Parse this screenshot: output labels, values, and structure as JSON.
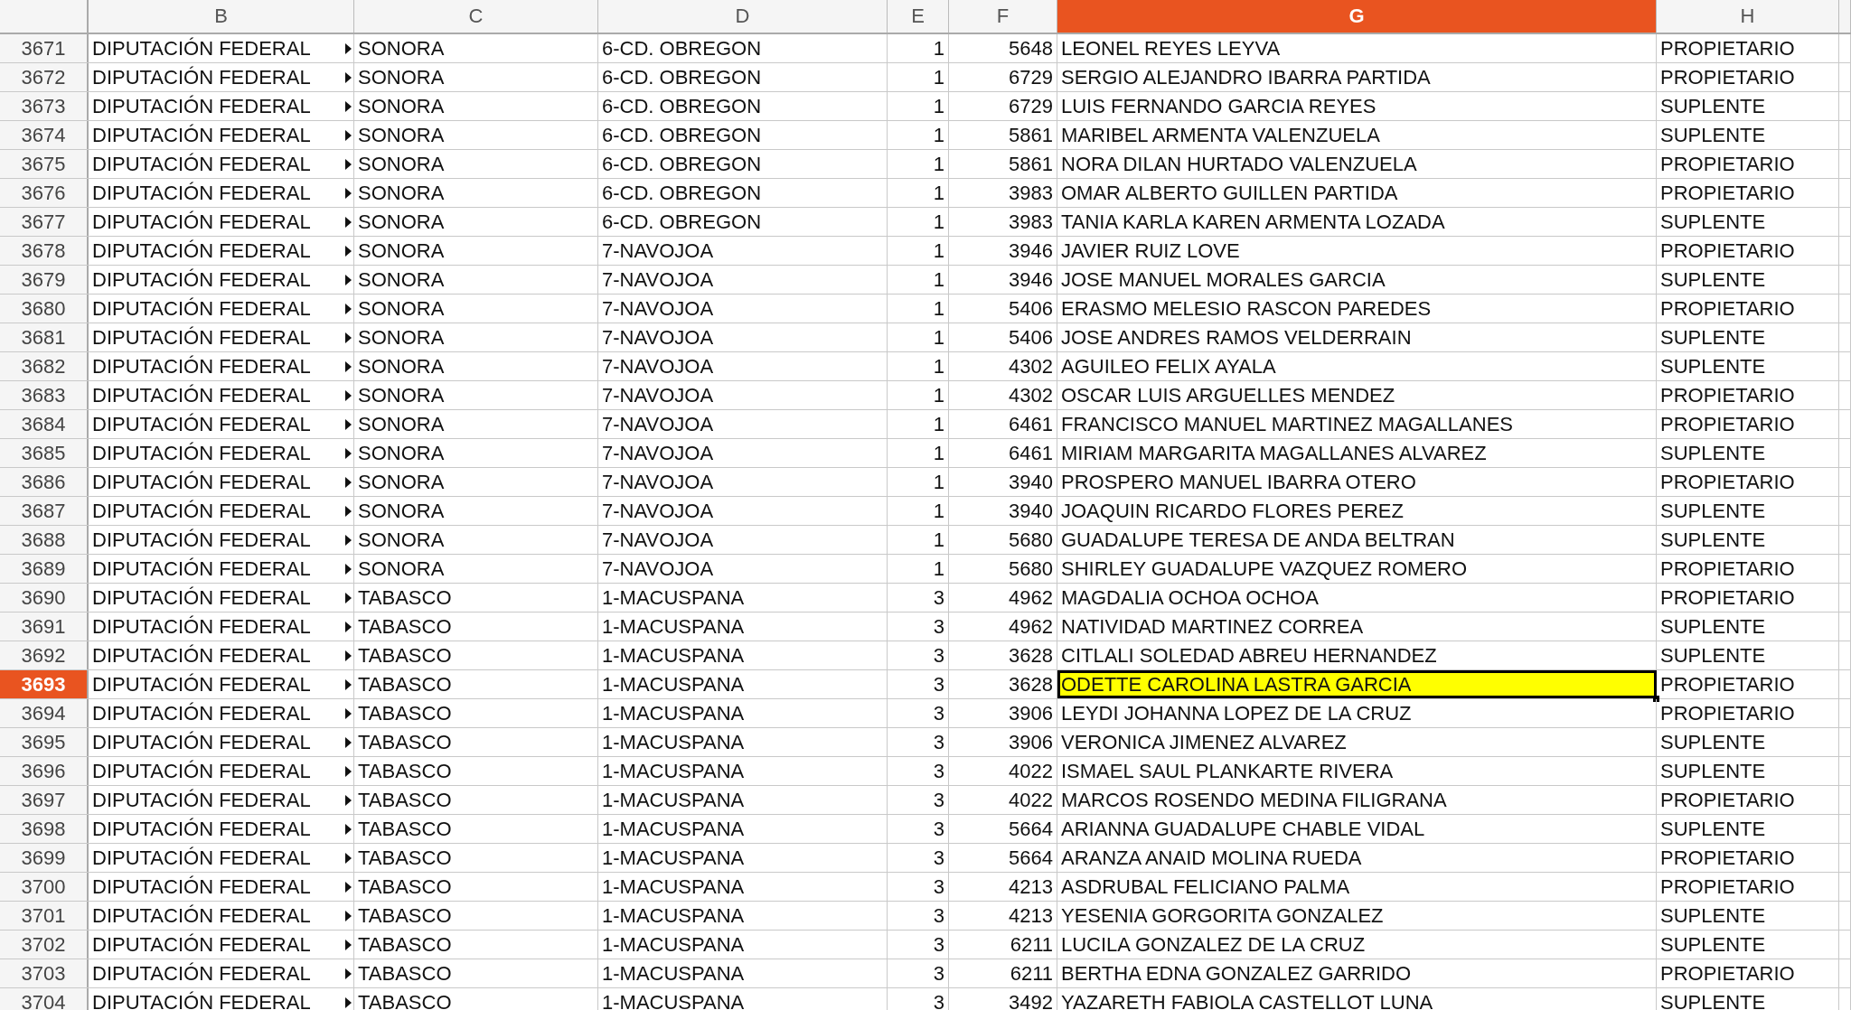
{
  "columns": [
    {
      "label": "B",
      "selected": false
    },
    {
      "label": "C",
      "selected": false
    },
    {
      "label": "D",
      "selected": false
    },
    {
      "label": "E",
      "selected": false
    },
    {
      "label": "F",
      "selected": false
    },
    {
      "label": "G",
      "selected": true
    },
    {
      "label": "H",
      "selected": false
    }
  ],
  "rows": [
    {
      "row": "3671",
      "b": "DIPUTACIÓN FEDERAL",
      "c": "SONORA",
      "d": "6-CD. OBREGON",
      "e": "1",
      "f": "5648",
      "g": "LEONEL REYES LEYVA",
      "h": "PROPIETARIO",
      "selected": false
    },
    {
      "row": "3672",
      "b": "DIPUTACIÓN FEDERAL",
      "c": "SONORA",
      "d": "6-CD. OBREGON",
      "e": "1",
      "f": "6729",
      "g": "SERGIO ALEJANDRO IBARRA PARTIDA",
      "h": "PROPIETARIO",
      "selected": false
    },
    {
      "row": "3673",
      "b": "DIPUTACIÓN FEDERAL",
      "c": "SONORA",
      "d": "6-CD. OBREGON",
      "e": "1",
      "f": "6729",
      "g": "LUIS FERNANDO GARCIA REYES",
      "h": "SUPLENTE",
      "selected": false
    },
    {
      "row": "3674",
      "b": "DIPUTACIÓN FEDERAL",
      "c": "SONORA",
      "d": "6-CD. OBREGON",
      "e": "1",
      "f": "5861",
      "g": "MARIBEL ARMENTA VALENZUELA",
      "h": "SUPLENTE",
      "selected": false
    },
    {
      "row": "3675",
      "b": "DIPUTACIÓN FEDERAL",
      "c": "SONORA",
      "d": "6-CD. OBREGON",
      "e": "1",
      "f": "5861",
      "g": "NORA DILAN HURTADO VALENZUELA",
      "h": "PROPIETARIO",
      "selected": false
    },
    {
      "row": "3676",
      "b": "DIPUTACIÓN FEDERAL",
      "c": "SONORA",
      "d": "6-CD. OBREGON",
      "e": "1",
      "f": "3983",
      "g": "OMAR ALBERTO GUILLEN PARTIDA",
      "h": "PROPIETARIO",
      "selected": false
    },
    {
      "row": "3677",
      "b": "DIPUTACIÓN FEDERAL",
      "c": "SONORA",
      "d": "6-CD. OBREGON",
      "e": "1",
      "f": "3983",
      "g": "TANIA KARLA KAREN ARMENTA LOZADA",
      "h": "SUPLENTE",
      "selected": false
    },
    {
      "row": "3678",
      "b": "DIPUTACIÓN FEDERAL",
      "c": "SONORA",
      "d": "7-NAVOJOA",
      "e": "1",
      "f": "3946",
      "g": "JAVIER RUIZ LOVE",
      "h": "PROPIETARIO",
      "selected": false
    },
    {
      "row": "3679",
      "b": "DIPUTACIÓN FEDERAL",
      "c": "SONORA",
      "d": "7-NAVOJOA",
      "e": "1",
      "f": "3946",
      "g": "JOSE MANUEL MORALES GARCIA",
      "h": "SUPLENTE",
      "selected": false
    },
    {
      "row": "3680",
      "b": "DIPUTACIÓN FEDERAL",
      "c": "SONORA",
      "d": "7-NAVOJOA",
      "e": "1",
      "f": "5406",
      "g": "ERASMO MELESIO RASCON PAREDES",
      "h": "PROPIETARIO",
      "selected": false
    },
    {
      "row": "3681",
      "b": "DIPUTACIÓN FEDERAL",
      "c": "SONORA",
      "d": "7-NAVOJOA",
      "e": "1",
      "f": "5406",
      "g": "JOSE ANDRES RAMOS VELDERRAIN",
      "h": "SUPLENTE",
      "selected": false
    },
    {
      "row": "3682",
      "b": "DIPUTACIÓN FEDERAL",
      "c": "SONORA",
      "d": "7-NAVOJOA",
      "e": "1",
      "f": "4302",
      "g": "AGUILEO FELIX AYALA",
      "h": "SUPLENTE",
      "selected": false
    },
    {
      "row": "3683",
      "b": "DIPUTACIÓN FEDERAL",
      "c": "SONORA",
      "d": "7-NAVOJOA",
      "e": "1",
      "f": "4302",
      "g": "OSCAR LUIS ARGUELLES MENDEZ",
      "h": "PROPIETARIO",
      "selected": false
    },
    {
      "row": "3684",
      "b": "DIPUTACIÓN FEDERAL",
      "c": "SONORA",
      "d": "7-NAVOJOA",
      "e": "1",
      "f": "6461",
      "g": "FRANCISCO MANUEL MARTINEZ MAGALLANES",
      "h": "PROPIETARIO",
      "selected": false
    },
    {
      "row": "3685",
      "b": "DIPUTACIÓN FEDERAL",
      "c": "SONORA",
      "d": "7-NAVOJOA",
      "e": "1",
      "f": "6461",
      "g": "MIRIAM MARGARITA MAGALLANES ALVAREZ",
      "h": "SUPLENTE",
      "selected": false
    },
    {
      "row": "3686",
      "b": "DIPUTACIÓN FEDERAL",
      "c": "SONORA",
      "d": "7-NAVOJOA",
      "e": "1",
      "f": "3940",
      "g": "PROSPERO MANUEL IBARRA OTERO",
      "h": "PROPIETARIO",
      "selected": false
    },
    {
      "row": "3687",
      "b": "DIPUTACIÓN FEDERAL",
      "c": "SONORA",
      "d": "7-NAVOJOA",
      "e": "1",
      "f": "3940",
      "g": "JOAQUIN RICARDO FLORES PEREZ",
      "h": "SUPLENTE",
      "selected": false
    },
    {
      "row": "3688",
      "b": "DIPUTACIÓN FEDERAL",
      "c": "SONORA",
      "d": "7-NAVOJOA",
      "e": "1",
      "f": "5680",
      "g": "GUADALUPE TERESA DE ANDA BELTRAN",
      "h": "SUPLENTE",
      "selected": false
    },
    {
      "row": "3689",
      "b": "DIPUTACIÓN FEDERAL",
      "c": "SONORA",
      "d": "7-NAVOJOA",
      "e": "1",
      "f": "5680",
      "g": "SHIRLEY GUADALUPE VAZQUEZ ROMERO",
      "h": "PROPIETARIO",
      "selected": false
    },
    {
      "row": "3690",
      "b": "DIPUTACIÓN FEDERAL",
      "c": "TABASCO",
      "d": "1-MACUSPANA",
      "e": "3",
      "f": "4962",
      "g": "MAGDALIA OCHOA OCHOA",
      "h": "PROPIETARIO",
      "selected": false
    },
    {
      "row": "3691",
      "b": "DIPUTACIÓN FEDERAL",
      "c": "TABASCO",
      "d": "1-MACUSPANA",
      "e": "3",
      "f": "4962",
      "g": "NATIVIDAD MARTINEZ CORREA",
      "h": "SUPLENTE",
      "selected": false
    },
    {
      "row": "3692",
      "b": "DIPUTACIÓN FEDERAL",
      "c": "TABASCO",
      "d": "1-MACUSPANA",
      "e": "3",
      "f": "3628",
      "g": "CITLALI SOLEDAD ABREU HERNANDEZ",
      "h": "SUPLENTE",
      "selected": false
    },
    {
      "row": "3693",
      "b": "DIPUTACIÓN FEDERAL",
      "c": "TABASCO",
      "d": "1-MACUSPANA",
      "e": "3",
      "f": "3628",
      "g": "ODETTE CAROLINA LASTRA GARCIA",
      "h": "PROPIETARIO",
      "selected": true
    },
    {
      "row": "3694",
      "b": "DIPUTACIÓN FEDERAL",
      "c": "TABASCO",
      "d": "1-MACUSPANA",
      "e": "3",
      "f": "3906",
      "g": "LEYDI JOHANNA LOPEZ DE LA CRUZ",
      "h": "PROPIETARIO",
      "selected": false
    },
    {
      "row": "3695",
      "b": "DIPUTACIÓN FEDERAL",
      "c": "TABASCO",
      "d": "1-MACUSPANA",
      "e": "3",
      "f": "3906",
      "g": "VERONICA JIMENEZ ALVAREZ",
      "h": "SUPLENTE",
      "selected": false
    },
    {
      "row": "3696",
      "b": "DIPUTACIÓN FEDERAL",
      "c": "TABASCO",
      "d": "1-MACUSPANA",
      "e": "3",
      "f": "4022",
      "g": "ISMAEL SAUL PLANKARTE RIVERA",
      "h": "SUPLENTE",
      "selected": false
    },
    {
      "row": "3697",
      "b": "DIPUTACIÓN FEDERAL",
      "c": "TABASCO",
      "d": "1-MACUSPANA",
      "e": "3",
      "f": "4022",
      "g": "MARCOS ROSENDO MEDINA FILIGRANA",
      "h": "PROPIETARIO",
      "selected": false
    },
    {
      "row": "3698",
      "b": "DIPUTACIÓN FEDERAL",
      "c": "TABASCO",
      "d": "1-MACUSPANA",
      "e": "3",
      "f": "5664",
      "g": "ARIANNA GUADALUPE CHABLE VIDAL",
      "h": "SUPLENTE",
      "selected": false
    },
    {
      "row": "3699",
      "b": "DIPUTACIÓN FEDERAL",
      "c": "TABASCO",
      "d": "1-MACUSPANA",
      "e": "3",
      "f": "5664",
      "g": "ARANZA ANAID MOLINA RUEDA",
      "h": "PROPIETARIO",
      "selected": false
    },
    {
      "row": "3700",
      "b": "DIPUTACIÓN FEDERAL",
      "c": "TABASCO",
      "d": "1-MACUSPANA",
      "e": "3",
      "f": "4213",
      "g": "ASDRUBAL FELICIANO PALMA",
      "h": "PROPIETARIO",
      "selected": false
    },
    {
      "row": "3701",
      "b": "DIPUTACIÓN FEDERAL",
      "c": "TABASCO",
      "d": "1-MACUSPANA",
      "e": "3",
      "f": "4213",
      "g": "YESENIA GORGORITA GONZALEZ",
      "h": "SUPLENTE",
      "selected": false
    },
    {
      "row": "3702",
      "b": "DIPUTACIÓN FEDERAL",
      "c": "TABASCO",
      "d": "1-MACUSPANA",
      "e": "3",
      "f": "6211",
      "g": "LUCILA GONZALEZ DE LA CRUZ",
      "h": "SUPLENTE",
      "selected": false
    },
    {
      "row": "3703",
      "b": "DIPUTACIÓN FEDERAL",
      "c": "TABASCO",
      "d": "1-MACUSPANA",
      "e": "3",
      "f": "6211",
      "g": "BERTHA EDNA GONZALEZ GARRIDO",
      "h": "PROPIETARIO",
      "selected": false
    },
    {
      "row": "3704",
      "b": "DIPUTACIÓN FEDERAL",
      "c": "TABASCO",
      "d": "1-MACUSPANA",
      "e": "3",
      "f": "3492",
      "g": "YAZARETH FABIOLA CASTELLOT LUNA",
      "h": "SUPLENTE",
      "selected": false
    }
  ]
}
